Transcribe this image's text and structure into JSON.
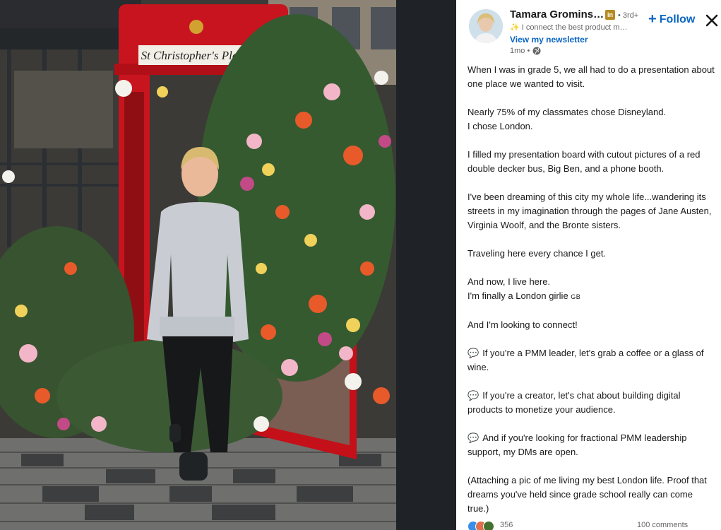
{
  "photo": {
    "booth_sign": "St Christopher's Place"
  },
  "author": {
    "name": "Tamara Gromins…",
    "degree": "• 3rd+",
    "headline": "I connect the best product m…",
    "newsletter_link": "View my newsletter",
    "time": "1mo •",
    "badge_text": "in"
  },
  "actions": {
    "follow_label": "Follow",
    "close_label": "✕"
  },
  "post": {
    "p1": "When I was in grade 5, we all had to do a presentation about one place we wanted to visit.",
    "p2a": "Nearly 75% of my classmates chose Disneyland.",
    "p2b": "I chose London.",
    "p3": "I filled my presentation board with cutout pictures of a red double decker bus, Big Ben, and a phone booth.",
    "p4": "I've been dreaming of this city my whole life...wandering its streets in my imagination through the pages of Jane Austen, Virginia Woolf, and the Bronte sisters.",
    "p5": "Traveling here every chance I get.",
    "p6a": "And now, I live here.",
    "p6b": "I'm finally a London girlie",
    "p6b_flag": "GB",
    "p7": "And I'm looking to connect!",
    "bullet_icon": "speech-bubble-icon",
    "b1": "If you're a PMM leader, let's grab a coffee or a glass of wine.",
    "b2": "If you're a creator, let's chat about building digital products to monetize your audience.",
    "b3": "And if you're looking for fractional PMM leadership support, my DMs are open.",
    "p8": "(Attaching a pic of me living my best London life. Proof that dreams you've held since grade school really can come true.)"
  },
  "social": {
    "reaction_count": "356",
    "comments": "100 comments"
  },
  "colors": {
    "brand_blue": "#0a66c2",
    "booth_red": "#c8141e",
    "dark_bg": "#1d2226"
  }
}
